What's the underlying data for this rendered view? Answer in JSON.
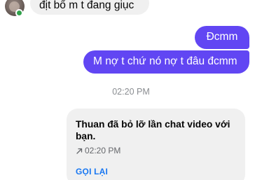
{
  "conversation": {
    "incoming_message": "địt bố m t đang giục",
    "outgoing_messages": [
      "Đcmm",
      "M nợ t chứ nó nợ t đâu đcmm"
    ],
    "timestamp": "02:20 PM",
    "missed_call": {
      "text": "Thuan đã bỏ lỡ lần chat video với bạn.",
      "time": "02:20 PM",
      "action_label": "GỌI LẠI",
      "action_color": "#1877f2"
    }
  },
  "colors": {
    "outgoing_bubble": "#6146f3",
    "incoming_bubble": "#f0f0f0",
    "online_indicator": "#31a24c"
  },
  "icons": {
    "missed_call_arrow": "arrow-up-right-icon"
  }
}
